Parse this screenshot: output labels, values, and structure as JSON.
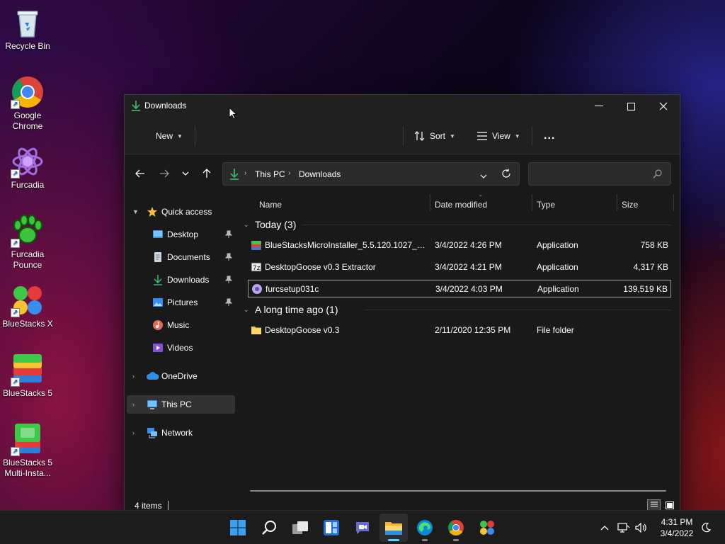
{
  "desktop": {
    "icons": [
      {
        "label": "Recycle Bin",
        "icon": "recycle-bin-icon"
      },
      {
        "label": "Google Chrome",
        "icon": "chrome-icon"
      },
      {
        "label": "Furcadia",
        "icon": "furcadia-icon"
      },
      {
        "label": "Furcadia Pounce",
        "icon": "paw-icon"
      },
      {
        "label": "BlueStacks X",
        "icon": "bluestacks-x-icon"
      },
      {
        "label": "BlueStacks 5",
        "icon": "bluestacks-5-icon"
      },
      {
        "label": "BlueStacks 5 Multi-Insta...",
        "icon": "bluestacks-multi-icon"
      }
    ]
  },
  "window": {
    "title": "Downloads",
    "commandbar": {
      "new_label": "New",
      "sort_label": "Sort",
      "view_label": "View",
      "more_label": "..."
    },
    "address": {
      "crumbs": [
        "This PC",
        "Downloads"
      ]
    },
    "search": {
      "placeholder": ""
    },
    "navpane": {
      "quick_access": "Quick access",
      "items": [
        {
          "label": "Desktop",
          "pinned": true
        },
        {
          "label": "Documents",
          "pinned": true
        },
        {
          "label": "Downloads",
          "pinned": true
        },
        {
          "label": "Pictures",
          "pinned": true
        },
        {
          "label": "Music",
          "pinned": false
        },
        {
          "label": "Videos",
          "pinned": false
        }
      ],
      "onedrive": "OneDrive",
      "this_pc": "This PC",
      "network": "Network"
    },
    "columns": {
      "name": "Name",
      "date": "Date modified",
      "type": "Type",
      "size": "Size"
    },
    "groups": [
      {
        "title": "Today (3)",
        "files": [
          {
            "name": "BlueStacksMicroInstaller_5.5.120.1027_na...",
            "date": "3/4/2022 4:26 PM",
            "type": "Application",
            "size": "758 KB",
            "icon": "bluestacks-installer-icon"
          },
          {
            "name": "DesktopGoose v0.3 Extractor",
            "date": "3/4/2022 4:21 PM",
            "type": "Application",
            "size": "4,317 KB",
            "icon": "archive-extractor-icon"
          },
          {
            "name": "furcsetup031c",
            "date": "3/4/2022 4:03 PM",
            "type": "Application",
            "size": "139,519 KB",
            "icon": "furcadia-setup-icon"
          }
        ]
      },
      {
        "title": "A long time ago (1)",
        "files": [
          {
            "name": "DesktopGoose v0.3",
            "date": "2/11/2020 12:35 PM",
            "type": "File folder",
            "size": "",
            "icon": "folder-icon"
          }
        ]
      }
    ],
    "status": {
      "item_count": "4 items"
    }
  },
  "taskbar": {
    "apps": [
      "start-icon",
      "search-icon",
      "task-view-icon",
      "widgets-icon",
      "chat-icon",
      "file-explorer-icon",
      "edge-icon",
      "chrome-icon",
      "bluestacks-x-icon"
    ],
    "clock": {
      "time": "4:31 PM",
      "date": "3/4/2022"
    }
  },
  "colors": {
    "accent": "#60cdff",
    "folder": "#f7c948",
    "download_green": "#3bb36a"
  }
}
